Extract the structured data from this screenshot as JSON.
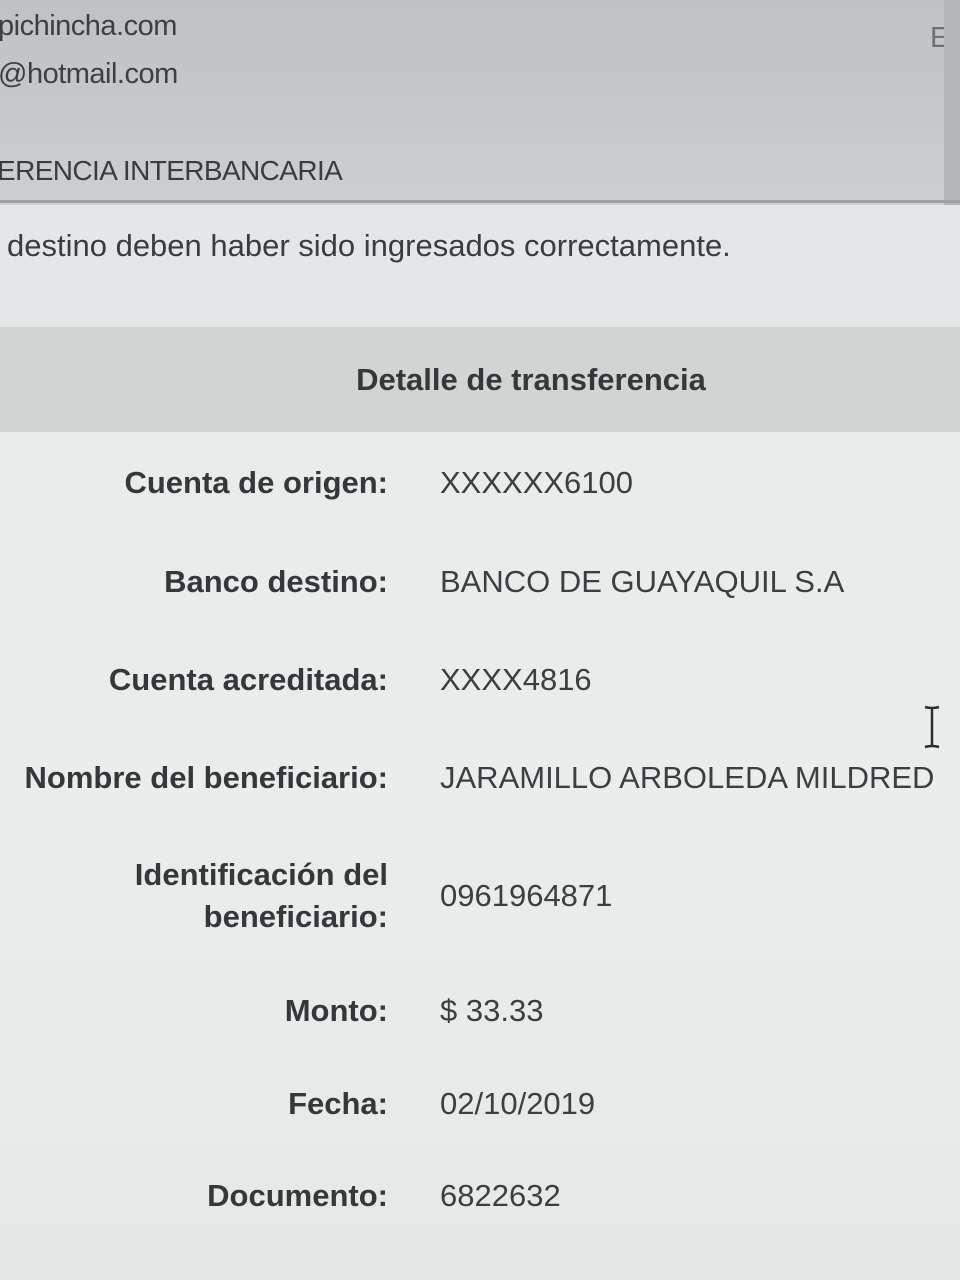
{
  "header": {
    "email_1": "pichincha.com",
    "email_2": "@hotmail.com",
    "corner_text": "Er",
    "section_title": "ERENCIA INTERBANCARIA"
  },
  "notice": "destino deben haber sido ingresados correctamente.",
  "detail": {
    "title": "Detalle de transferencia",
    "rows": [
      {
        "label": "Cuenta de origen:",
        "value": "XXXXXX6100"
      },
      {
        "label": "Banco destino:",
        "value": "BANCO DE GUAYAQUIL S.A"
      },
      {
        "label": "Cuenta acreditada:",
        "value": "XXXX4816"
      },
      {
        "label": "Nombre del beneficiario:",
        "value": "JARAMILLO ARBOLEDA MILDRED"
      },
      {
        "label": "Identificación del beneficiario:",
        "value": "0961964871"
      },
      {
        "label": "Monto:",
        "value": "$ 33.33"
      },
      {
        "label": "Fecha:",
        "value": "02/10/2019"
      },
      {
        "label": "Documento:",
        "value": "6822632"
      }
    ]
  },
  "colors": {
    "page_background": "#e4e6e7",
    "header_background": "#c4c7c8",
    "panel_header": "#d2d4d4",
    "text": "#35383a"
  },
  "icons": [
    "text-cursor-icon"
  ]
}
